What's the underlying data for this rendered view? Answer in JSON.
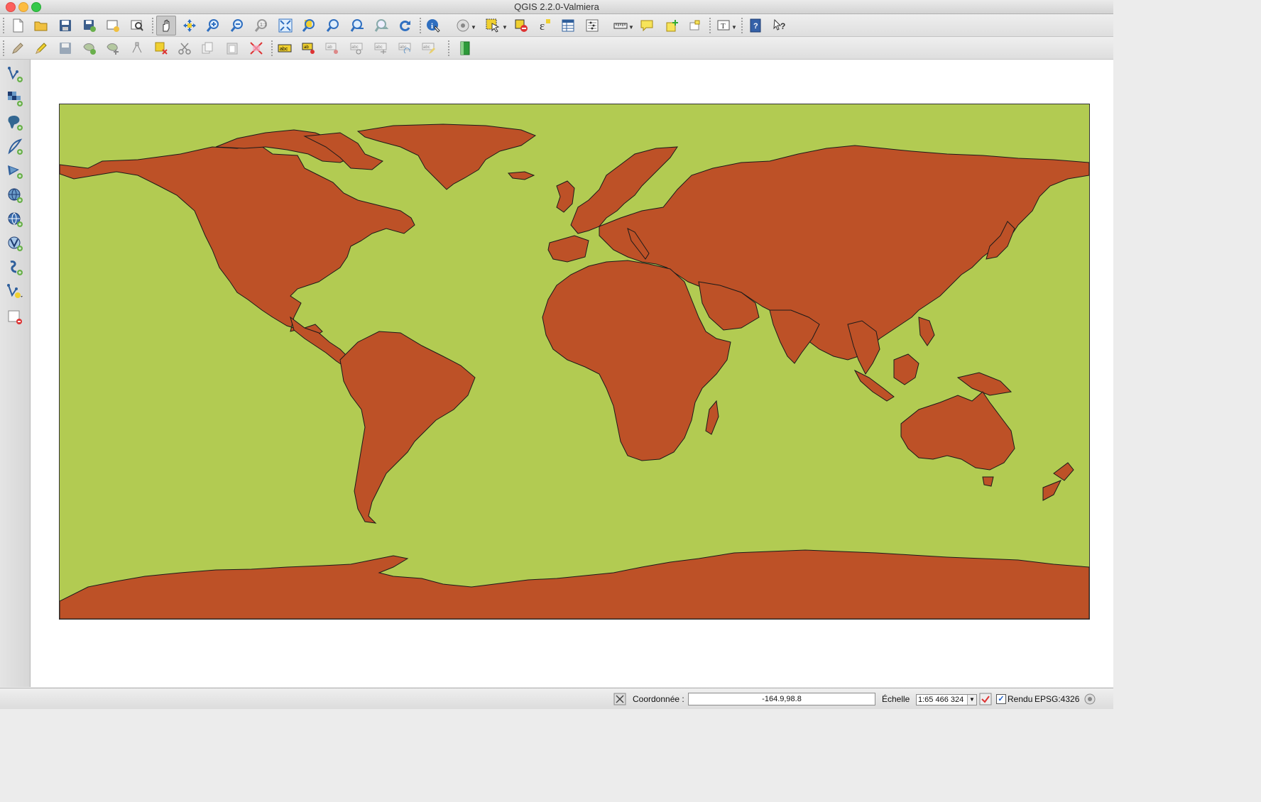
{
  "window": {
    "title": "QGIS 2.2.0-Valmiera"
  },
  "toolbar_main": {
    "tools": [
      "new-project-icon",
      "open-project-icon",
      "save-project-icon",
      "save-as-icon",
      "new-print-composer-icon",
      "composer-manager-icon",
      "pan-icon",
      "pan-to-selection-icon",
      "zoom-in-icon",
      "zoom-out-icon",
      "zoom-actual-size-icon",
      "zoom-full-icon",
      "zoom-to-selection-icon",
      "zoom-to-layer-icon",
      "zoom-last-icon",
      "zoom-next-icon",
      "refresh-icon",
      "identify-icon",
      "run-action-icon",
      "select-features-icon",
      "deselect-icon",
      "field-calculator-icon",
      "attribute-table-icon",
      "statistics-icon",
      "measure-icon",
      "map-tips-icon",
      "new-bookmark-icon",
      "show-bookmarks-icon",
      "text-annotation-icon",
      "help-icon",
      "whats-this-icon"
    ]
  },
  "toolbar_digitizing": {
    "tools": [
      "current-edits-icon",
      "toggle-editing-icon",
      "save-edits-icon",
      "add-feature-icon",
      "move-feature-icon",
      "node-tool-icon",
      "delete-selected-icon",
      "cut-features-icon",
      "copy-features-icon",
      "paste-features-icon",
      "label-tool-icon",
      "layer-labeling-icon",
      "pin-labels-icon",
      "show-hide-labels-icon",
      "move-label-icon",
      "rotate-label-icon",
      "change-label-icon",
      "edit-html-icon"
    ]
  },
  "left_toolbar": {
    "tools": [
      "add-vector-layer-icon",
      "add-raster-layer-icon",
      "add-postgis-layer-icon",
      "add-spatialite-layer-icon",
      "add-mssql-layer-icon",
      "add-wms-layer-icon",
      "add-wcs-layer-icon",
      "add-wfs-layer-icon",
      "add-delimited-text-icon",
      "new-shapefile-icon",
      "remove-layer-icon"
    ]
  },
  "map": {
    "land_color": "#bd5127",
    "water_color": "#b2cb52",
    "outline_color": "#1a1a1a"
  },
  "statusbar": {
    "coordinate_label": "Coordonnée :",
    "coordinate_value": "-164.9,98.8",
    "scale_label": "Échelle",
    "scale_value": "1:65 466 324",
    "render_label": "Rendu",
    "render_checked": "✓",
    "crs_label": "EPSG:4326"
  }
}
